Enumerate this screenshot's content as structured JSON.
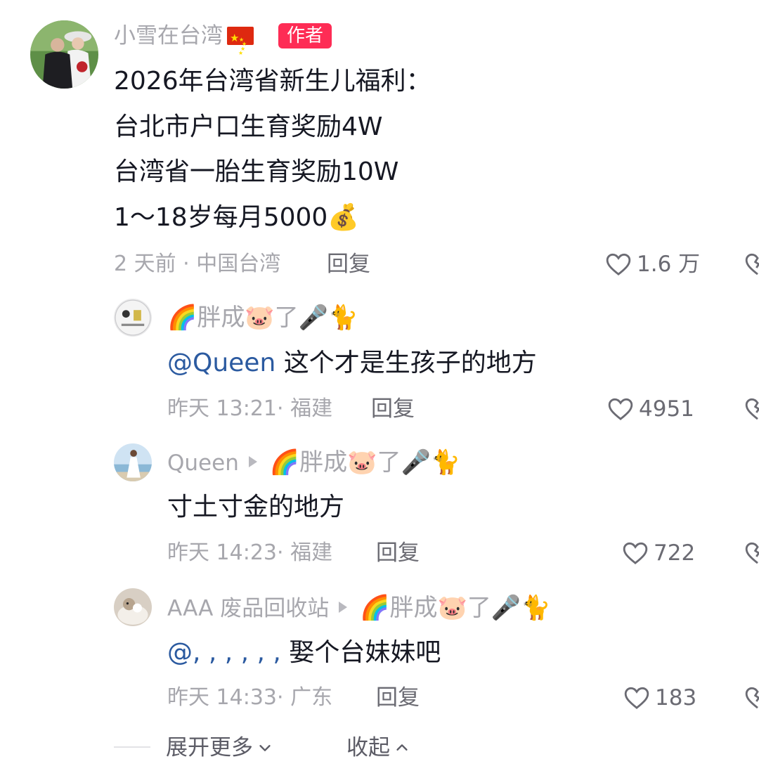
{
  "main_comment": {
    "author": "小雪在台湾",
    "author_badge": "作者",
    "lines": [
      "2026年台湾省新生儿福利：",
      "台北市户口生育奖励4W",
      "台湾省一胎生育奖励10W",
      "1～18岁每月5000💰"
    ],
    "meta": "2 天前 · 中国台湾",
    "reply_label": "回复",
    "likes": "1.6 万"
  },
  "replies": [
    {
      "author_prefix": "🌈胖成🐷了🎤🐈",
      "reply_to": "",
      "mention": "@Queen",
      "text": " 这个才是生孩子的地方",
      "meta": "昨天 13:21· 福建",
      "reply_label": "回复",
      "likes": "4951"
    },
    {
      "author_prefix": "Queen",
      "reply_to": "🌈胖成🐷了🎤🐈",
      "mention": "",
      "text": "寸土寸金的地方",
      "meta": "昨天 14:23· 福建",
      "reply_label": "回复",
      "likes": "722"
    },
    {
      "author_prefix": "AAA 废品回收站",
      "reply_to": "🌈胖成🐷了🎤🐈",
      "mention": "@, , , , , ,",
      "text": " 娶个台妹妹吧",
      "meta": "昨天 14:33· 广东",
      "reply_label": "回复",
      "likes": "183"
    }
  ],
  "footer": {
    "expand_label": "展开更多",
    "collapse_label": "收起"
  },
  "colors": {
    "accent": "#fe2c55",
    "text_primary": "#161823",
    "text_secondary": "#a7a7ad",
    "mention": "#2b5aa0"
  }
}
